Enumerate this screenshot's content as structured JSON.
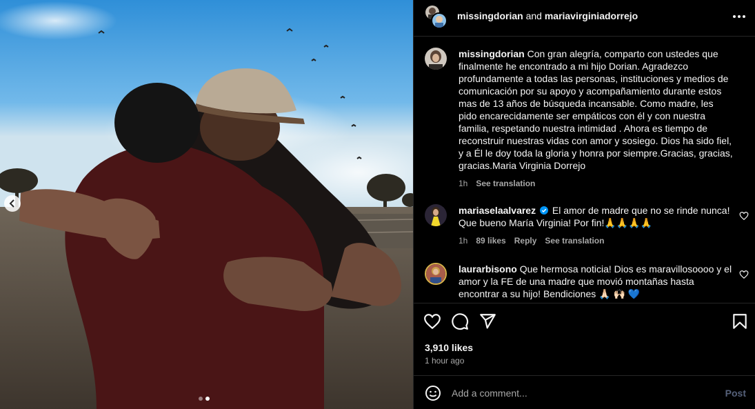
{
  "header": {
    "user1": "missingdorian",
    "joiner": "and",
    "user2": "mariavirginiadorrejo"
  },
  "caption": {
    "username": "missingdorian",
    "text": "Con gran alegría, comparto con ustedes que finalmente he encontrado a mi hijo Dorian. Agradezco profundamente a todas las personas, instituciones y medios de comunicación por su apoyo y acompañamiento durante estos mas de 13 años de búsqueda incansable. Como madre, les pido encarecidamente ser empáticos con él y con nuestra familia, respetando nuestra intimidad . Ahora es tiempo de reconstruir nuestras vidas con amor y sosiego. Dios ha sido fiel, y a Él le doy toda la gloria y honra por siempre.Gracias, gracias, gracias.Maria Virginia Dorrejo",
    "time": "1h",
    "see_translation": "See translation"
  },
  "comments": [
    {
      "username": "mariaselaalvarez",
      "verified": true,
      "text": "El amor de madre que no se rinde nunca! Que bueno María Virginia! Por fin!🙏🙏🙏🙏",
      "time": "1h",
      "likes": "89 likes",
      "reply": "Reply",
      "see_translation": "See translation"
    },
    {
      "username": "laurarbisono",
      "verified": false,
      "text": "Que hermosa noticia! Dios es maravillosoooo y el amor y la FE de una madre que movió montañas hasta encontrar a su hijo! Bendiciones 🙏🏻 🙌🏻 💙"
    }
  ],
  "actions": {
    "icons": [
      "heart-icon",
      "comment-icon",
      "share-icon",
      "bookmark-icon"
    ]
  },
  "stats": {
    "likes": "3,910 likes",
    "posted": "1 hour ago"
  },
  "composer": {
    "placeholder": "Add a comment...",
    "post_label": "Post"
  },
  "carousel": {
    "slide_count": 2,
    "active_slide": 2
  },
  "colors": {
    "background": "#000000",
    "text": "#f5f5f5",
    "muted": "#a8a8a8",
    "divider": "#262626",
    "verified": "#0095f6",
    "post_disabled": "#56617a"
  }
}
